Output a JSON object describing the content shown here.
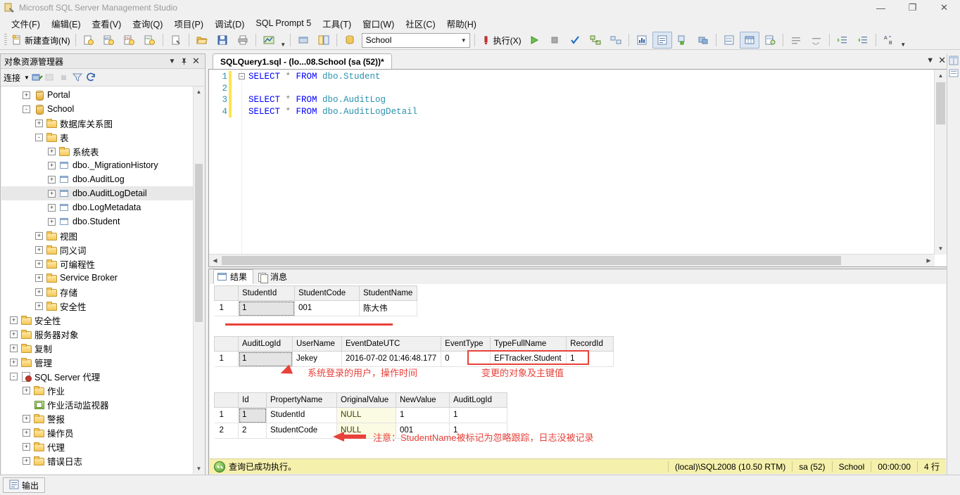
{
  "window": {
    "title": "Microsoft SQL Server Management Studio",
    "app_icon": "ssms-icon",
    "buttons": {
      "minimize": "—",
      "maximize": "❐",
      "close": "✕"
    }
  },
  "menubar": {
    "items": [
      {
        "label": "文件(F)",
        "name": "menu-file"
      },
      {
        "label": "编辑(E)",
        "name": "menu-edit"
      },
      {
        "label": "查看(V)",
        "name": "menu-view"
      },
      {
        "label": "查询(Q)",
        "name": "menu-query"
      },
      {
        "label": "项目(P)",
        "name": "menu-project"
      },
      {
        "label": "调试(D)",
        "name": "menu-debug"
      },
      {
        "label": "SQL Prompt 5",
        "name": "menu-sql-prompt"
      },
      {
        "label": "工具(T)",
        "name": "menu-tools"
      },
      {
        "label": "窗口(W)",
        "name": "menu-window"
      },
      {
        "label": "社区(C)",
        "name": "menu-community"
      },
      {
        "label": "帮助(H)",
        "name": "menu-help"
      }
    ]
  },
  "toolbar": {
    "new_query_label": "新建查询(N)",
    "database_value": "School",
    "execute_label": "执行(X)",
    "icons": [
      "new-query-icon",
      "new-database-engine-query-icon",
      "new-analysis-mdx-query-icon",
      "new-analysis-dmx-query-icon",
      "new-analysis-xmla-query-icon",
      "new-script-icon",
      "open-file-icon",
      "save-icon",
      "print-icon",
      "design-query-icon",
      "execute-icon",
      "debug-icon",
      "stop-icon",
      "parse-icon",
      "display-estimated-plan-icon",
      "include-actual-plan-icon",
      "include-client-statistics-icon",
      "results-to-text-icon",
      "results-to-grid-icon",
      "results-to-file-icon",
      "comment-icon",
      "uncomment-icon",
      "indent-icon",
      "outdent-icon",
      "specify-values-icon"
    ]
  },
  "object_explorer": {
    "title": "对象资源管理器",
    "connect_label": "连接",
    "tree": [
      {
        "label": "Portal",
        "icon": "database-icon",
        "indent": 3,
        "expander": "+"
      },
      {
        "label": "School",
        "icon": "database-icon",
        "indent": 3,
        "expander": "-"
      },
      {
        "label": "数据库关系图",
        "icon": "folder-icon",
        "indent": 4,
        "expander": "+"
      },
      {
        "label": "表",
        "icon": "folder-icon",
        "indent": 4,
        "expander": "-"
      },
      {
        "label": "系统表",
        "icon": "folder-icon",
        "indent": 5,
        "expander": "+"
      },
      {
        "label": "dbo._MigrationHistory",
        "icon": "table-icon",
        "indent": 5,
        "expander": "+"
      },
      {
        "label": "dbo.AuditLog",
        "icon": "table-icon",
        "indent": 5,
        "expander": "+"
      },
      {
        "label": "dbo.AuditLogDetail",
        "icon": "table-icon",
        "indent": 5,
        "expander": "+",
        "selected": true
      },
      {
        "label": "dbo.LogMetadata",
        "icon": "table-icon",
        "indent": 5,
        "expander": "+"
      },
      {
        "label": "dbo.Student",
        "icon": "table-icon",
        "indent": 5,
        "expander": "+"
      },
      {
        "label": "视图",
        "icon": "folder-icon",
        "indent": 4,
        "expander": "+"
      },
      {
        "label": "同义词",
        "icon": "folder-icon",
        "indent": 4,
        "expander": "+"
      },
      {
        "label": "可编程性",
        "icon": "folder-icon",
        "indent": 4,
        "expander": "+"
      },
      {
        "label": "Service Broker",
        "icon": "folder-icon",
        "indent": 4,
        "expander": "+"
      },
      {
        "label": "存储",
        "icon": "folder-icon",
        "indent": 4,
        "expander": "+"
      },
      {
        "label": "安全性",
        "icon": "folder-icon",
        "indent": 4,
        "expander": "+"
      },
      {
        "label": "安全性",
        "icon": "folder-icon",
        "indent": 2,
        "expander": "+"
      },
      {
        "label": "服务器对象",
        "icon": "folder-icon",
        "indent": 2,
        "expander": "+"
      },
      {
        "label": "复制",
        "icon": "folder-icon",
        "indent": 2,
        "expander": "+"
      },
      {
        "label": "管理",
        "icon": "folder-icon",
        "indent": 2,
        "expander": "+"
      },
      {
        "label": "SQL Server 代理",
        "icon": "sql-agent-icon",
        "indent": 2,
        "expander": "-"
      },
      {
        "label": "作业",
        "icon": "folder-icon",
        "indent": 3,
        "expander": "+"
      },
      {
        "label": "作业活动监视器",
        "icon": "job-activity-monitor-icon",
        "indent": 3,
        "expander": ""
      },
      {
        "label": "警报",
        "icon": "folder-icon",
        "indent": 3,
        "expander": "+"
      },
      {
        "label": "操作员",
        "icon": "folder-icon",
        "indent": 3,
        "expander": "+"
      },
      {
        "label": "代理",
        "icon": "folder-icon",
        "indent": 3,
        "expander": "+"
      },
      {
        "label": "错误日志",
        "icon": "folder-icon",
        "indent": 3,
        "expander": "+"
      }
    ]
  },
  "editor": {
    "tab_label": "SQLQuery1.sql - (lo...08.School (sa (52))*",
    "lines": [
      {
        "num": "1",
        "tokens": [
          {
            "t": "SELECT",
            "c": "kw"
          },
          {
            "t": " * ",
            "c": "op"
          },
          {
            "t": "FROM ",
            "c": "kw"
          },
          {
            "t": "dbo.Student",
            "c": "obj"
          }
        ]
      },
      {
        "num": "2",
        "tokens": []
      },
      {
        "num": "3",
        "tokens": [
          {
            "t": "SELECT",
            "c": "kw"
          },
          {
            "t": " * ",
            "c": "op"
          },
          {
            "t": "FROM ",
            "c": "kw"
          },
          {
            "t": "dbo.AuditLog",
            "c": "obj"
          }
        ]
      },
      {
        "num": "4",
        "tokens": [
          {
            "t": "SELECT",
            "c": "kw"
          },
          {
            "t": " * ",
            "c": "op"
          },
          {
            "t": "FROM ",
            "c": "kw"
          },
          {
            "t": "dbo.AuditLogDetail",
            "c": "obj"
          }
        ]
      }
    ]
  },
  "results": {
    "tabs": [
      {
        "label": "结果",
        "icon": "grid-results-icon",
        "active": true
      },
      {
        "label": "消息",
        "icon": "messages-icon",
        "active": false
      }
    ],
    "grid1": {
      "name": "student-result-grid",
      "columns": [
        "StudentId",
        "StudentCode",
        "StudentName"
      ],
      "rows": [
        {
          "n": "1",
          "cells": [
            "1",
            "001",
            "陈大伟"
          ]
        }
      ]
    },
    "grid2": {
      "name": "auditlog-result-grid",
      "columns": [
        "AuditLogId",
        "UserName",
        "EventDateUTC",
        "EventType",
        "TypeFullName",
        "RecordId"
      ],
      "rows": [
        {
          "n": "1",
          "cells": [
            "1",
            "Jekey",
            "2016-07-02 01:46:48.177",
            "0",
            "EFTracker.Student",
            "1"
          ]
        }
      ]
    },
    "grid3": {
      "name": "auditlogdetail-result-grid",
      "columns": [
        "Id",
        "PropertyName",
        "OriginalValue",
        "NewValue",
        "AuditLogId"
      ],
      "rows": [
        {
          "n": "1",
          "cells": [
            "1",
            "StudentId",
            "NULL",
            "1",
            "1"
          ]
        },
        {
          "n": "2",
          "cells": [
            "2",
            "StudentCode",
            "NULL",
            "001",
            "1"
          ]
        }
      ]
    },
    "annotations": [
      {
        "name": "annotation-user-and-time",
        "text": "系统登录的用户，操作时间"
      },
      {
        "name": "annotation-changed-object",
        "text": "变更的对象及主键值"
      },
      {
        "name": "annotation-ignored-property",
        "text": "注意：StudentName被标记为忽略跟踪，日志没被记录"
      }
    ],
    "annotation_color": "#e8413a"
  },
  "status": {
    "message": "查询已成功执行。",
    "server": "(local)\\SQL2008 (10.50 RTM)",
    "user": "sa (52)",
    "database": "School",
    "elapsed": "00:00:00",
    "rows": "4 行"
  },
  "bottom": {
    "output_tab": "输出",
    "output_icon": "output-icon"
  }
}
